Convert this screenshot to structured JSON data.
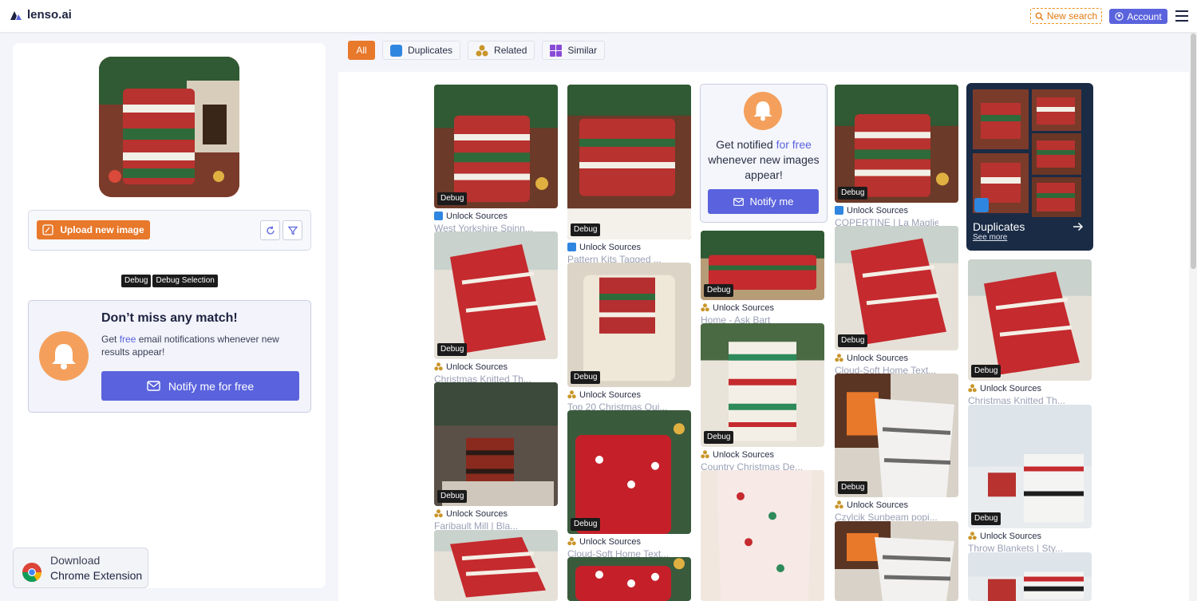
{
  "header": {
    "logo_text": "lenso.ai",
    "new_search_label": "New search",
    "account_label": "Account",
    "accent_color": "#5a63dd",
    "orange_color": "#e8782a"
  },
  "left": {
    "upload_label": "Upload new image",
    "debug_tags": [
      "Debug",
      "Debug Selection"
    ],
    "promo": {
      "title": "Don’t miss any match!",
      "text_pre": "Get ",
      "text_link": "free",
      "text_post": " email notifications whenever new results appear!",
      "button_label": "Notify me for free"
    },
    "chrome": {
      "line1": "Download",
      "line2": "Chrome Extension"
    }
  },
  "filters": [
    {
      "label": "All",
      "icon": "none",
      "active": true
    },
    {
      "label": "Duplicates",
      "icon": "duplicates-icon",
      "active": false
    },
    {
      "label": "Related",
      "icon": "related-icon",
      "active": false
    },
    {
      "label": "Similar",
      "icon": "similar-icon",
      "active": false
    }
  ],
  "notify_card": {
    "line1_pre": "Get notified ",
    "line1_link": "for free",
    "line2": "whenever new images",
    "line3": "appear!",
    "button_label": "Notify me"
  },
  "dup_card": {
    "title": "Duplicates",
    "link": "See more"
  },
  "results": [
    {
      "debug": "Debug",
      "source": "Unlock Sources",
      "caption": "West Yorkshire Spinn...",
      "kind": "dup"
    },
    {
      "debug": "Debug",
      "source": "Unlock Sources",
      "caption": "Pattern Kits Tagged ...",
      "kind": "dup"
    },
    {
      "debug": "Debug",
      "source": "Unlock Sources",
      "caption": "COPERTINE | La Maglie...",
      "kind": "dup"
    },
    {
      "debug": "Debug",
      "source": "Unlock Sources",
      "caption": "Christmas Knitted Th...",
      "kind": "rel"
    },
    {
      "debug": "Debug",
      "source": "Unlock Sources",
      "caption": "Top 20 Christmas Qui...",
      "kind": "rel"
    },
    {
      "debug": "Debug",
      "source": "Unlock Sources",
      "caption": "Home - Ask Bart",
      "kind": "rel"
    },
    {
      "debug": "Debug",
      "source": "Unlock Sources",
      "caption": "Cloud-Soft Home Text...",
      "kind": "rel"
    },
    {
      "debug": "Debug",
      "source": "Unlock Sources",
      "caption": "Christmas Knitted Th...",
      "kind": "rel"
    },
    {
      "debug": "Debug",
      "source": "Unlock Sources",
      "caption": "Faribault Mill | Bla...",
      "kind": "rel"
    },
    {
      "debug": "Debug",
      "source": "Unlock Sources",
      "caption": "Cloud-Soft Home Text...",
      "kind": "rel"
    },
    {
      "debug": "Debug",
      "source": "Unlock Sources",
      "caption": "Country Christmas De...",
      "kind": "rel"
    },
    {
      "debug": "Debug",
      "source": "Unlock Sources",
      "caption": "Czylcik Sunbeam popi...",
      "kind": "rel"
    },
    {
      "debug": "Debug",
      "source": "Unlock Sources",
      "caption": "Throw Blankets | Sty...",
      "kind": "rel"
    }
  ]
}
